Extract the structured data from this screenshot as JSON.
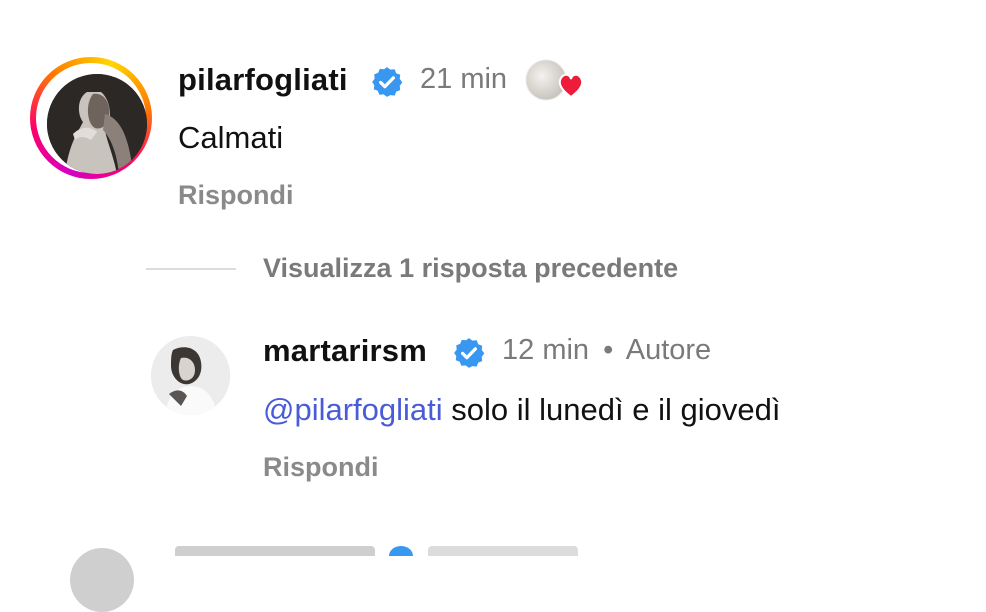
{
  "comments": [
    {
      "username": "pilarfogliati",
      "time": "21 min",
      "text": "Calmati",
      "reply_label": "Rispondi",
      "verified_icon": "verified-badge-icon",
      "liked_by_author_icon": "author-heart-icon"
    },
    {
      "username": "martarirsm",
      "time": "12 min",
      "separator": "•",
      "author_label": "Autore",
      "mention": "@pilarfogliati",
      "text": " solo il lunedì e il giovedì",
      "reply_label": "Rispondi",
      "verified_icon": "verified-badge-icon"
    }
  ],
  "thread": {
    "view_previous_label": "Visualizza 1 risposta precedente"
  },
  "colors": {
    "verified": "#3897f0",
    "mention": "#4a5bd8",
    "heart": "#ed1c3a",
    "muted": "#7a7a7a"
  }
}
